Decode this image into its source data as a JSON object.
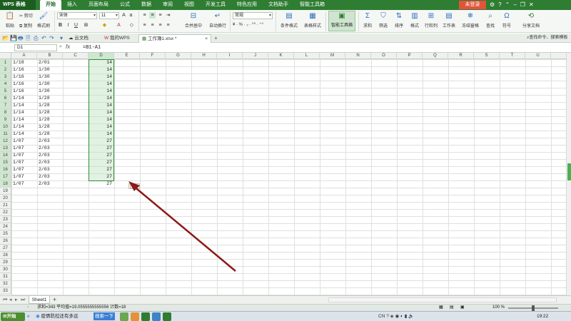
{
  "app": {
    "name": "WPS 表格",
    "login_label": "未登录"
  },
  "ribbon_tabs": [
    "开始",
    "插入",
    "页面布局",
    "公式",
    "数据",
    "审阅",
    "视图",
    "开发工具",
    "特色应用",
    "文档助手",
    "智能工具箱"
  ],
  "ribbon": {
    "paste": "粘贴",
    "cut": "剪切",
    "copy": "复制",
    "format_painter": "格式刷",
    "font_name": "宋体",
    "font_size": "11",
    "merge_center": "合并居中",
    "wrap_text": "自动换行",
    "number_format": "常规",
    "conditional_format": "条件格式",
    "table_style": "表格样式",
    "smart_toolbox": "智能工具箱",
    "sum": "求和",
    "filter": "筛选",
    "sort": "排序",
    "format": "格式",
    "row_col": "行和列",
    "worksheet": "工作表",
    "freeze": "冻结窗格",
    "find": "查找",
    "symbol": "符号",
    "share": "分享文档"
  },
  "doc_tabs": {
    "cloud": "云文档",
    "mywps": "我的WPS",
    "workbook": "工作簿1.xlsx *"
  },
  "find_command": "查找命令、搜索模板",
  "formula_bar": {
    "name_box": "D1",
    "fx": "fx",
    "formula": "=B1-A1"
  },
  "columns": [
    "A",
    "B",
    "C",
    "D",
    "E",
    "F",
    "G",
    "H",
    "I",
    "J",
    "K",
    "L",
    "M",
    "N",
    "O",
    "P",
    "Q",
    "R",
    "S",
    "T",
    "U"
  ],
  "rows": [
    "1",
    "2",
    "3",
    "4",
    "5",
    "6",
    "7",
    "8",
    "9",
    "10",
    "11",
    "12",
    "13",
    "14",
    "15",
    "16",
    "17",
    "18",
    "19",
    "20",
    "21",
    "22",
    "23",
    "24",
    "25",
    "26",
    "27",
    "28",
    "29",
    "30",
    "31",
    "32",
    "33"
  ],
  "sheet_data": {
    "col_a": [
      "1/18",
      "1/16",
      "1/16",
      "1/16",
      "1/16",
      "1/14",
      "1/14",
      "1/14",
      "1/14",
      "1/14",
      "1/14",
      "1/07",
      "1/07",
      "1/07",
      "1/07",
      "1/07",
      "1/07",
      "1/07"
    ],
    "col_b": [
      "2/01",
      "1/30",
      "1/30",
      "1/30",
      "1/30",
      "1/28",
      "1/28",
      "1/28",
      "1/28",
      "1/28",
      "1/28",
      "2/03",
      "2/03",
      "2/03",
      "2/03",
      "2/03",
      "2/03",
      "2/03"
    ],
    "col_d": [
      "14",
      "14",
      "14",
      "14",
      "14",
      "14",
      "14",
      "14",
      "14",
      "14",
      "14",
      "27",
      "27",
      "27",
      "27",
      "27",
      "27",
      "27"
    ]
  },
  "sheet_tab": "Sheet1",
  "status": {
    "text": "求和=343  平均值=19.0555555555556  计数=18",
    "zoom": "100 %"
  },
  "taskbar": {
    "start": "开始",
    "ie_item": "疫情防控还有多远",
    "search": "搜索一下",
    "clock": "19:22"
  }
}
